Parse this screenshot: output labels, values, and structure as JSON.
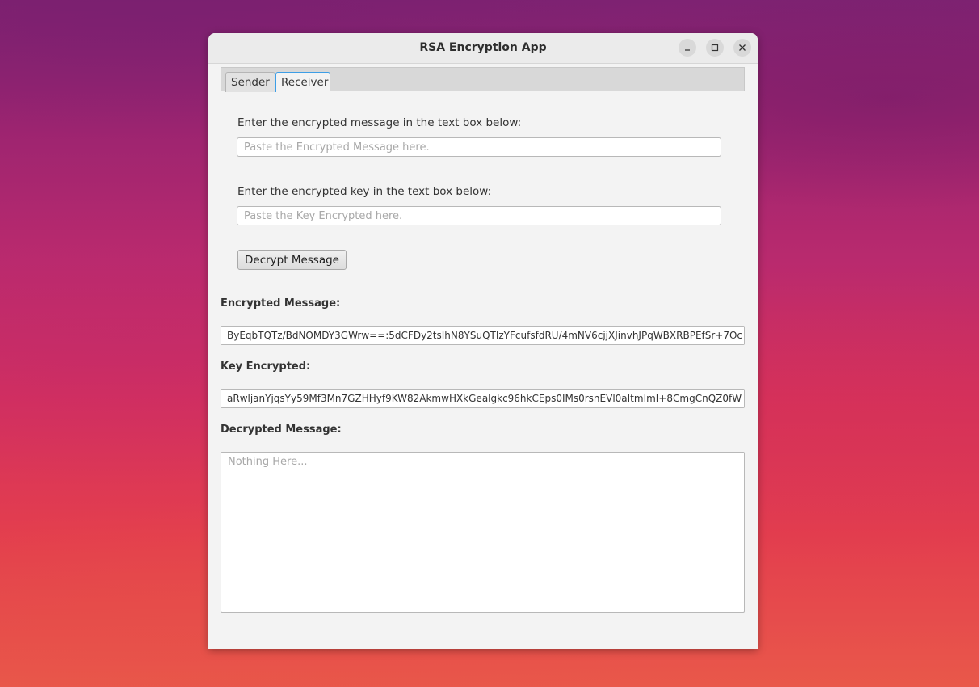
{
  "window": {
    "title": "RSA Encryption App",
    "minimize_icon": "minimize-icon",
    "maximize_icon": "maximize-icon",
    "close_icon": "close-icon"
  },
  "tabs": [
    {
      "label": "Sender",
      "active": false
    },
    {
      "label": "Receiver",
      "active": true
    }
  ],
  "receiver": {
    "message_prompt": "Enter the encrypted message in the text box below:",
    "message_placeholder": "Paste the Encrypted Message here.",
    "key_prompt": "Enter the encrypted key in the text box below:",
    "key_placeholder": "Paste the Key Encrypted here.",
    "decrypt_button": "Decrypt Message",
    "encrypted_message_heading": "Encrypted Message:",
    "encrypted_message_value": "ByEqbTQTz/BdNOMDY3GWrw==:5dCFDy2tsIhN8YSuQTIzYFcufsfdRU/4mNV6cjjXJinvhJPqWBXRBPEfSr+7Oc",
    "key_encrypted_heading": "Key Encrypted:",
    "key_encrypted_value": "aRwljanYjqsYy59Mf3Mn7GZHHyf9KW82AkmwHXkGealgkc96hkCEps0IMs0rsnEVl0aItmImI+8CmgCnQZ0fW",
    "decrypted_message_heading": "Decrypted Message:",
    "decrypted_message_placeholder": "Nothing Here..."
  },
  "colors": {
    "focus_accent": "#3d9ee6",
    "window_bg": "#f3f3f3"
  }
}
